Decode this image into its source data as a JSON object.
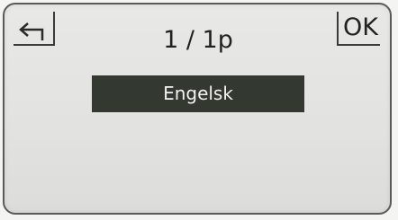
{
  "softkeys": {
    "back_icon": "back-arrow-icon",
    "ok_label": "OK"
  },
  "header": {
    "page_indicator": "1 / 1p"
  },
  "menu": {
    "items": [
      {
        "label": "Engelsk",
        "selected": true
      }
    ]
  },
  "colors": {
    "screen_background": "#e2e2e0",
    "selection_background": "#333830",
    "selection_text": "#f2f2f2",
    "text": "#222222"
  }
}
